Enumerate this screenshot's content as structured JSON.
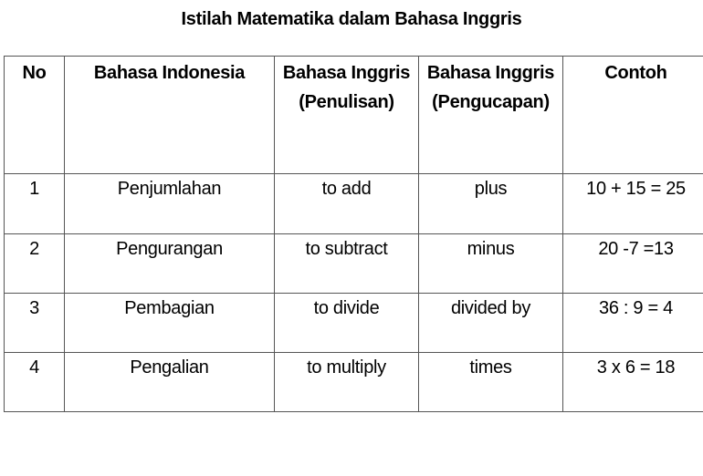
{
  "title": "Istilah Matematika dalam Bahasa Inggris",
  "table": {
    "headers": [
      "No",
      "Bahasa Indonesia",
      "Bahasa Inggris (Penulisan)",
      "Bahasa Inggris (Pengucapan)",
      "Contoh"
    ],
    "rows": [
      {
        "no": "1",
        "indonesia": "Penjumlahan",
        "penulisan": "to add",
        "pengucapan": "plus",
        "contoh": "10 + 15 = 25"
      },
      {
        "no": "2",
        "indonesia": "Pengurangan",
        "penulisan": "to subtract",
        "pengucapan": "minus",
        "contoh": "20 -7 =13"
      },
      {
        "no": "3",
        "indonesia": "Pembagian",
        "penulisan": "to divide",
        "pengucapan": "divided by",
        "contoh": "36 : 9 = 4"
      },
      {
        "no": "4",
        "indonesia": "Pengalian",
        "penulisan": "to multiply",
        "pengucapan": "times",
        "contoh": "3 x 6 = 18"
      }
    ]
  }
}
